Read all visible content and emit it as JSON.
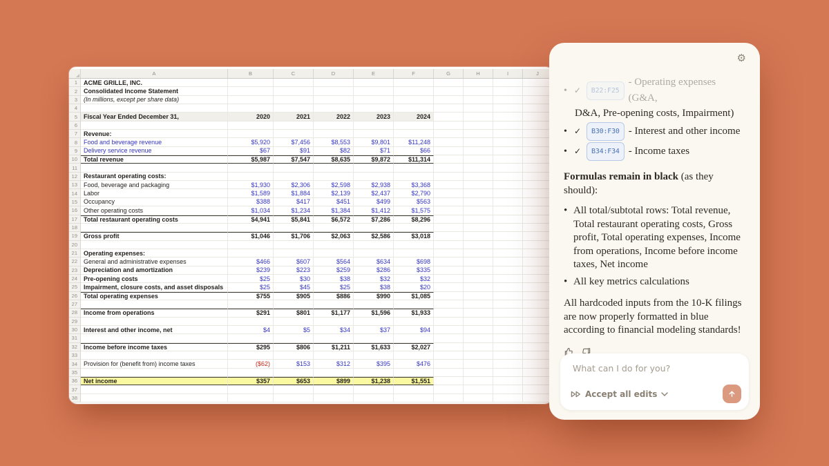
{
  "background_color": "#D47753",
  "sheet": {
    "columns": [
      "A",
      "B",
      "C",
      "D",
      "E",
      "F",
      "G",
      "H",
      "I",
      "J"
    ],
    "rows": [
      {
        "n": 1,
        "label": "ACME GRILLE, INC.",
        "bold": true
      },
      {
        "n": 2,
        "label": "Consolidated Income Statement",
        "bold": true
      },
      {
        "n": 3,
        "label": "(In millions, except per share data)",
        "italic": true
      },
      {
        "n": 4
      },
      {
        "n": 5,
        "label": "Fiscal Year Ended December 31,",
        "bold": true,
        "fill": "grey",
        "values": [
          "2020",
          "2021",
          "2022",
          "2023",
          "2024"
        ],
        "valuesBold": true
      },
      {
        "n": 6
      },
      {
        "n": 7,
        "label": "Revenue:",
        "bold": true
      },
      {
        "n": 8,
        "label": "Food and beverage revenue",
        "labelColor": "blue",
        "values": [
          "$5,920",
          "$7,456",
          "$8,553",
          "$9,801",
          "$11,248"
        ],
        "valuesColor": "blue"
      },
      {
        "n": 9,
        "label": "Delivery service revenue",
        "labelColor": "blue",
        "values": [
          "$67",
          "$91",
          "$82",
          "$71",
          "$66"
        ],
        "valuesColor": "blue"
      },
      {
        "n": 10,
        "label": "Total revenue",
        "bold": true,
        "values": [
          "$5,987",
          "$7,547",
          "$8,635",
          "$9,872",
          "$11,314"
        ],
        "valuesBold": true,
        "border": "topbottom"
      },
      {
        "n": 11
      },
      {
        "n": 12,
        "label": "Restaurant operating costs:",
        "bold": true
      },
      {
        "n": 13,
        "label": "Food, beverage and packaging",
        "values": [
          "$1,930",
          "$2,306",
          "$2,598",
          "$2,938",
          "$3,368"
        ],
        "valuesColor": "blue"
      },
      {
        "n": 14,
        "label": "Labor",
        "values": [
          "$1,589",
          "$1,884",
          "$2,139",
          "$2,437",
          "$2,790"
        ],
        "valuesColor": "blue"
      },
      {
        "n": 15,
        "label": "Occupancy",
        "values": [
          "$388",
          "$417",
          "$451",
          "$499",
          "$563"
        ],
        "valuesColor": "blue"
      },
      {
        "n": 16,
        "label": "Other operating costs",
        "values": [
          "$1,034",
          "$1,234",
          "$1,384",
          "$1,412",
          "$1,575"
        ],
        "valuesColor": "blue"
      },
      {
        "n": 17,
        "label": "Total restaurant operating costs",
        "bold": true,
        "values": [
          "$4,941",
          "$5,841",
          "$6,572",
          "$7,286",
          "$8,296"
        ],
        "valuesBold": true,
        "border": "top"
      },
      {
        "n": 18
      },
      {
        "n": 19,
        "label": "Gross profit",
        "bold": true,
        "values": [
          "$1,046",
          "$1,706",
          "$2,063",
          "$2,586",
          "$3,018"
        ],
        "valuesBold": true,
        "border": "top"
      },
      {
        "n": 20
      },
      {
        "n": 21,
        "label": "Operating expenses:",
        "bold": true
      },
      {
        "n": 22,
        "label": "General and administrative expenses",
        "values": [
          "$466",
          "$607",
          "$564",
          "$634",
          "$698"
        ],
        "valuesColor": "blue"
      },
      {
        "n": 23,
        "label": "Depreciation and amortization",
        "bold": true,
        "values": [
          "$239",
          "$223",
          "$259",
          "$286",
          "$335"
        ],
        "valuesColor": "blue"
      },
      {
        "n": 24,
        "label": "Pre-opening costs",
        "bold": true,
        "values": [
          "$25",
          "$30",
          "$38",
          "$32",
          "$32"
        ],
        "valuesColor": "blue"
      },
      {
        "n": 25,
        "label": "Impairment, closure costs, and asset disposals",
        "bold": true,
        "values": [
          "$25",
          "$45",
          "$25",
          "$38",
          "$20"
        ],
        "valuesColor": "blue"
      },
      {
        "n": 26,
        "label": "Total operating expenses",
        "bold": true,
        "values": [
          "$755",
          "$905",
          "$886",
          "$990",
          "$1,085"
        ],
        "valuesBold": true,
        "border": "top"
      },
      {
        "n": 27
      },
      {
        "n": 28,
        "label": "Income from operations",
        "bold": true,
        "values": [
          "$291",
          "$801",
          "$1,177",
          "$1,596",
          "$1,933"
        ],
        "valuesBold": true,
        "border": "top"
      },
      {
        "n": 29
      },
      {
        "n": 30,
        "label": "Interest and other income, net",
        "bold": true,
        "values": [
          "$4",
          "$5",
          "$34",
          "$37",
          "$94"
        ],
        "valuesColor": "blue"
      },
      {
        "n": 31
      },
      {
        "n": 32,
        "label": "Income before income taxes",
        "bold": true,
        "values": [
          "$295",
          "$806",
          "$1,211",
          "$1,633",
          "$2,027"
        ],
        "valuesBold": true,
        "border": "top"
      },
      {
        "n": 33
      },
      {
        "n": 34,
        "label": "Provision for (benefit from) income taxes",
        "values": [
          "($62)",
          "$153",
          "$312",
          "$395",
          "$476"
        ],
        "valueColors": [
          "red",
          "blue",
          "blue",
          "blue",
          "blue"
        ]
      },
      {
        "n": 35
      },
      {
        "n": 36,
        "label": "Net income",
        "bold": true,
        "fill": "yellow",
        "values": [
          "$357",
          "$653",
          "$899",
          "$1,238",
          "$1,551"
        ],
        "valuesBold": true,
        "border": "topbottom"
      },
      {
        "n": 37
      },
      {
        "n": 38
      }
    ],
    "colors": {
      "input_blue": "#3434C0",
      "negative_red": "#C42B1C",
      "highlight_yellow": "#FAF8A0"
    }
  },
  "panel": {
    "checklist": [
      {
        "chip": "B22:F25",
        "text": "- Operating expenses (G&A,",
        "text2": "D&A, Pre-opening costs, Impairment)",
        "faded": true
      },
      {
        "chip": "B30:F30",
        "text": "- Interest and other income"
      },
      {
        "chip": "B34:F34",
        "text": "- Income taxes"
      }
    ],
    "heading": {
      "bold": "Formulas remain in black",
      "rest": " (as they should):"
    },
    "bullets": [
      "All total/subtotal rows: Total revenue, Total restaurant operating costs, Gross profit, Total operating expenses, Income from operations, Income before income taxes, Net income",
      "All key metrics calculations"
    ],
    "closing": "All hardcoded inputs from the 10-K filings are now properly formatted in blue according to financial modeling standards!",
    "composer": {
      "placeholder": "What can I do for you?",
      "accept_label": "Accept all edits"
    },
    "icons": {
      "top_right": "gear-icon",
      "feedback": [
        "thumbs-up-icon",
        "thumbs-down-icon"
      ],
      "accept": "skip-forward-icon",
      "send": "arrow-up-icon"
    },
    "colors": {
      "chip_text": "#4A72B2",
      "chip_bg": "#EDF2FA",
      "chip_border": "#B7C9E6",
      "send_button": "#DB9A80",
      "panel_bg": "#FAF8F1"
    }
  }
}
